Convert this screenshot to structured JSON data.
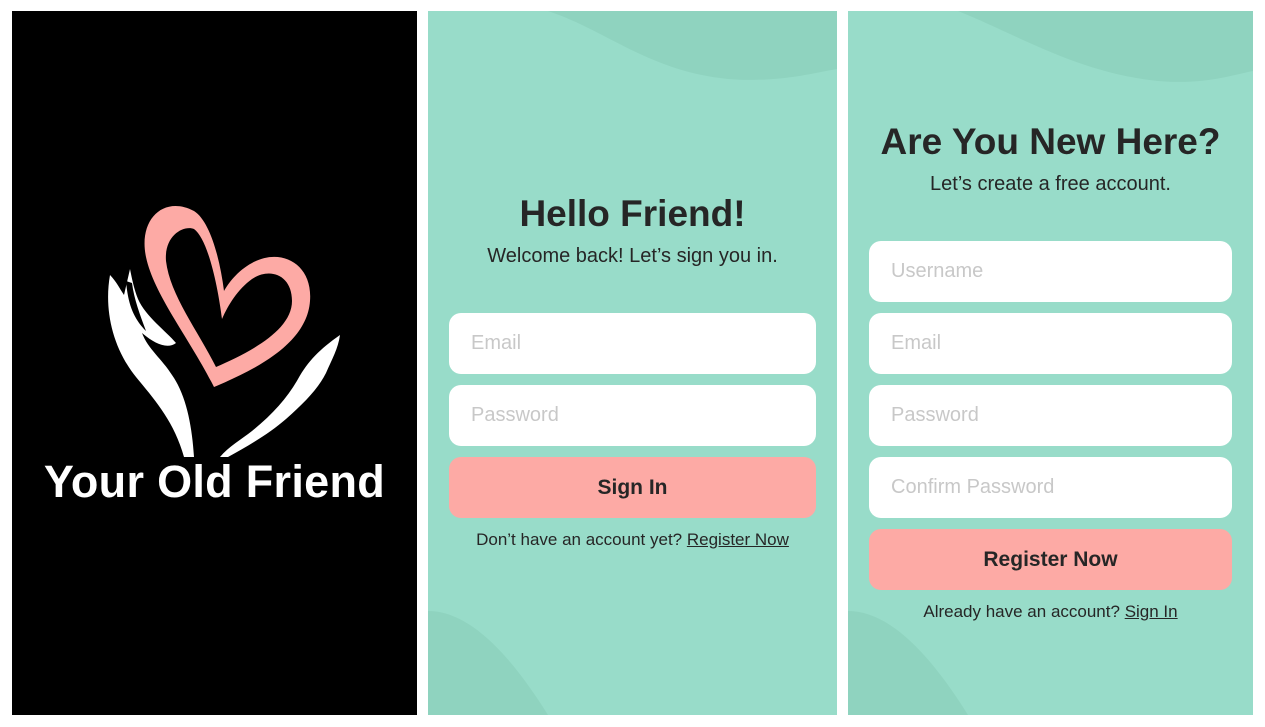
{
  "splash": {
    "app_name": "Your Old Friend",
    "logo_icon": "heart-in-hands-icon",
    "colors": {
      "background": "#000000",
      "heart": "#fdaaa5",
      "hands": "#ffffff"
    }
  },
  "signin": {
    "title": "Hello Friend!",
    "subtitle": "Welcome back! Let’s sign you in.",
    "email_placeholder": "Email",
    "password_placeholder": "Password",
    "submit_label": "Sign In",
    "footer_text": "Don’t have an account yet?",
    "footer_link": "Register Now"
  },
  "register": {
    "title": "Are You New Here?",
    "subtitle": "Let’s create a free account.",
    "username_placeholder": "Username",
    "email_placeholder": "Email",
    "password_placeholder": "Password",
    "confirm_placeholder": "Confirm Password",
    "submit_label": "Register Now",
    "footer_text": "Already have an account?",
    "footer_link": "Sign In"
  },
  "colors": {
    "mint_background": "#98dcc9",
    "mint_wave": "#8fd3bf",
    "accent_button": "#fdaaa5",
    "text_dark": "#262626",
    "placeholder": "#c8c8c8"
  }
}
